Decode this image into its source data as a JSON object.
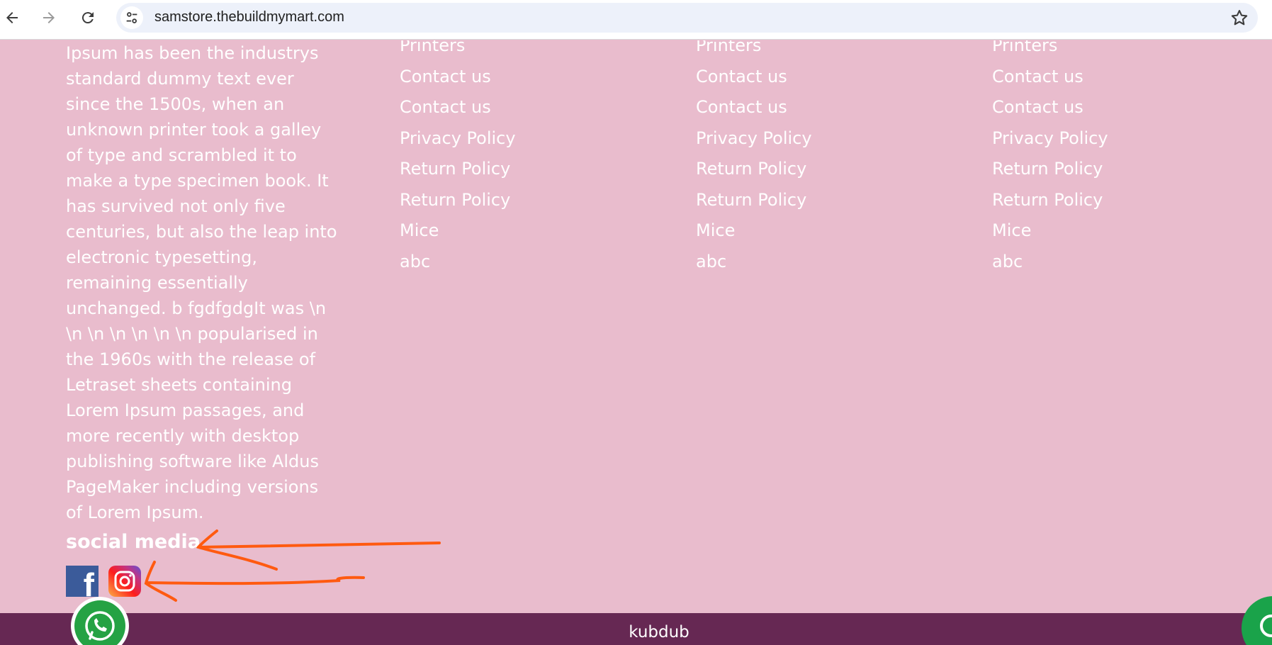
{
  "browser": {
    "url": "samstore.thebuildmymart.com"
  },
  "footer": {
    "about_text": "Ipsum has been the industrys standard dummy text ever since the 1500s, when an unknown printer took a galley of type and scrambled it to make a type specimen book. It has survived not only five centuries, but also the leap into electronic typesetting, remaining essentially unchanged. b fgdfgdgIt was \\n \\n \\n \\n \\n \\n \\n popularised in the 1960s with the release of Letraset sheets containing Lorem Ipsum passages, and more recently with desktop publishing software like Aldus PageMaker including versions of Lorem Ipsum.",
    "columns": [
      {
        "links": [
          "Printers",
          "Contact us",
          "Contact us",
          "Privacy Policy",
          "Return Policy",
          "Return Policy",
          "Mice",
          "abc"
        ]
      },
      {
        "links": [
          "Printers",
          "Contact us",
          "Contact us",
          "Privacy Policy",
          "Return Policy",
          "Return Policy",
          "Mice",
          "abc"
        ]
      },
      {
        "links": [
          "Printers",
          "Contact us",
          "Contact us",
          "Privacy Policy",
          "Return Policy",
          "Return Policy",
          "Mice",
          "abc"
        ]
      }
    ],
    "social_title": "social media",
    "social_icons": [
      "facebook-icon",
      "instagram-icon"
    ],
    "facebook_glyph": "f",
    "bottom_text": "kubdub"
  },
  "colors": {
    "footer_bg": "#e9bccd",
    "bottom_bar": "#662853",
    "annotation": "#ff5a10",
    "whatsapp": "#25a244"
  }
}
